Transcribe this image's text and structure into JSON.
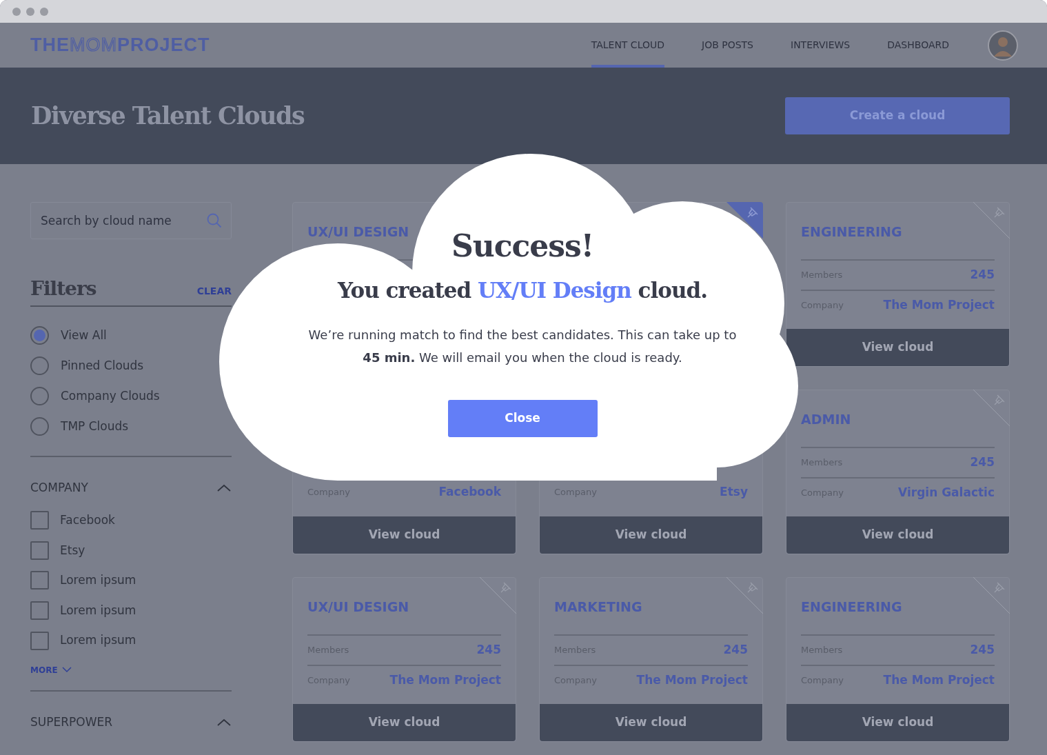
{
  "nav": {
    "logo": [
      {
        "text": "THE",
        "kind": "solid"
      },
      {
        "text": "MOM",
        "kind": "outline"
      },
      {
        "text": "PROJECT",
        "kind": "solid"
      }
    ],
    "items": [
      {
        "label": "TALENT CLOUD",
        "selected": true
      },
      {
        "label": "JOB POSTS",
        "selected": false
      },
      {
        "label": "INTERVIEWS",
        "selected": false
      },
      {
        "label": "DASHBOARD",
        "selected": false
      }
    ]
  },
  "hero": {
    "title": "Diverse Talent Clouds",
    "button": "Create a cloud"
  },
  "sidebar": {
    "search": {
      "placeholder": "Search by cloud name"
    },
    "filters_title": "Filters",
    "clear": "CLEAR",
    "views": [
      {
        "label": "View All",
        "selected": true
      },
      {
        "label": "Pinned Clouds",
        "selected": false
      },
      {
        "label": "Company Clouds",
        "selected": false
      },
      {
        "label": "TMP Clouds",
        "selected": false
      }
    ],
    "sections": [
      {
        "title": "COMPANY",
        "expanded": true,
        "options": [
          {
            "label": "Facebook",
            "checked": false
          },
          {
            "label": "Etsy",
            "checked": false
          },
          {
            "label": "Lorem ipsum",
            "checked": false
          },
          {
            "label": "Lorem ipsum",
            "checked": false
          },
          {
            "label": "Lorem ipsum",
            "checked": false
          }
        ],
        "more": "MORE"
      },
      {
        "title": "SUPERPOWER",
        "expanded": true
      }
    ]
  },
  "cards": [
    {
      "title": "UX/UI DESIGN"
    },
    {
      "pinned": true
    },
    {
      "title": "ENGINEERING",
      "members_label": "Members",
      "members": "245",
      "company_label": "Company",
      "company": "The Mom Project",
      "button": "View cloud",
      "pinned": false
    },
    {
      "company_label": "Company",
      "company": "Facebook",
      "button": "View cloud"
    },
    {
      "company_label": "Company",
      "company": "Etsy",
      "button": "View cloud"
    },
    {
      "title": "ADMIN",
      "members_label": "Members",
      "members": "245",
      "company_label": "Company",
      "company": "Virgin Galactic",
      "button": "View cloud",
      "pinned": false
    },
    {
      "title": "UX/UI DESIGN",
      "members_label": "Members",
      "members": "245",
      "company_label": "Company",
      "company": "The Mom Project",
      "button": "View cloud",
      "pinned": false
    },
    {
      "title": "MARKETING",
      "members_label": "Members",
      "members": "245",
      "company_label": "Company",
      "company": "The Mom Project",
      "button": "View cloud",
      "pinned": false
    },
    {
      "title": "ENGINEERING",
      "members_label": "Members",
      "members": "245",
      "company_label": "Company",
      "company": "The Mom Project",
      "button": "View cloud",
      "pinned": false
    }
  ],
  "modal": {
    "title": "Success!",
    "subtitle": {
      "before": "You created ",
      "highlight": "UX/UI Design",
      "after": " cloud."
    },
    "message": "We’re running match to find the best candidates. This can take up to **45 min.** We will email you when the cloud is ready.",
    "button": "Close"
  }
}
